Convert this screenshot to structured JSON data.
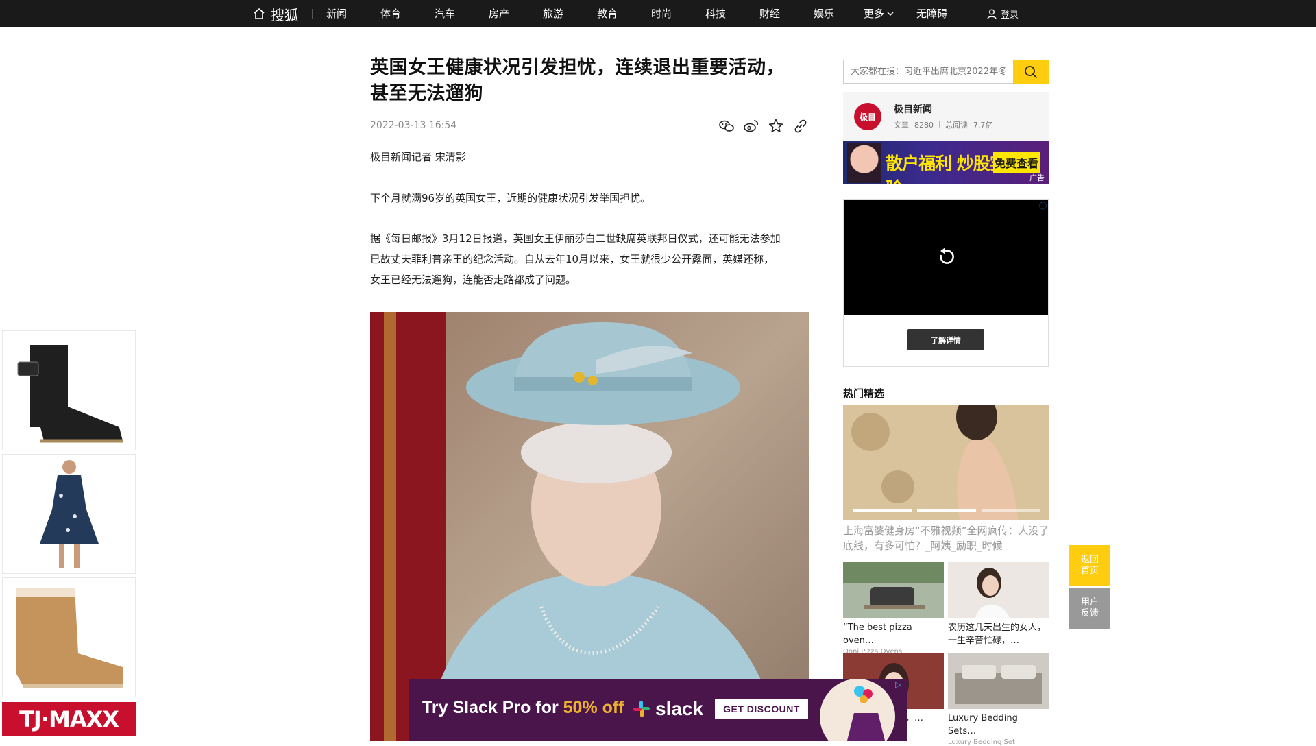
{
  "nav": {
    "logo": "搜狐",
    "items": [
      "新闻",
      "体育",
      "汽车",
      "房产",
      "旅游",
      "教育",
      "时尚",
      "科技",
      "财经",
      "娱乐"
    ],
    "more": "更多",
    "accessibility": "无障碍",
    "login": "登录"
  },
  "article": {
    "title_line1": "英国女王健康状况引发担忧，连续退出重要活动，",
    "title_line2": "甚至无法遛狗",
    "date": "2022-03-13 16:54",
    "reporter": "极目新闻记者 宋清影",
    "p1": "下个月就满96岁的英国女王，近期的健康状况引发举国担忧。",
    "p2a": "据《每日邮报》3月12日报道，英国女王伊丽莎白二世缺席英联邦日仪式，还可能无法参加",
    "p2b": "已故丈夫菲利普亲王的纪念活动。自从去年10月以来，女王就很少公开露面，英媒还称，",
    "p2c": "女王已经无法遛狗，连能否走路都成了问题。"
  },
  "search": {
    "placeholder": "大家都在搜：习近平出席北京2022年冬"
  },
  "author": {
    "avatar_text": "极目",
    "name": "极目新闻",
    "articles_label": "文章",
    "articles_count": "8280",
    "reads_label": "总阅读",
    "reads_count": "7.7亿"
  },
  "banner_ad": {
    "text": "散户福利 炒股实战经验",
    "cta": "免费查看",
    "tag": "广告"
  },
  "video_ad": {
    "cta": "了解详情",
    "info_icon": "ⓘ"
  },
  "hot": {
    "title": "热门精选",
    "caption": "上海富婆健身房“不雅视频”全网疯传：人没了底线，有多可怕？_阿姨_励职_时候",
    "recs": [
      {
        "title": "“The best pizza oven…",
        "source": "Ooni Pizza Ovens"
      },
      {
        "title": "农历这几天出生的女人，一生辛苦忙碌，…",
        "source": ""
      },
      {
        "title": "…人的，…彩形，…",
        "source": ""
      },
      {
        "title": "Luxury Bedding Sets…",
        "source": "Luxury Bedding Set"
      }
    ]
  },
  "side": {
    "back_home": "返回首页",
    "feedback": "用户反馈"
  },
  "left_ad": {
    "brand": "TJ·MAXX"
  },
  "slack_ad": {
    "text_pre": "Try Slack Pro for ",
    "text_hl": "50% off",
    "logo": "slack",
    "cta": "GET DISCOUNT"
  },
  "colors": {
    "nav_bg": "#1a1a1a",
    "accent_yellow": "#fecd10",
    "slack_purple": "#4a154b",
    "tj_red": "#c8102e"
  }
}
